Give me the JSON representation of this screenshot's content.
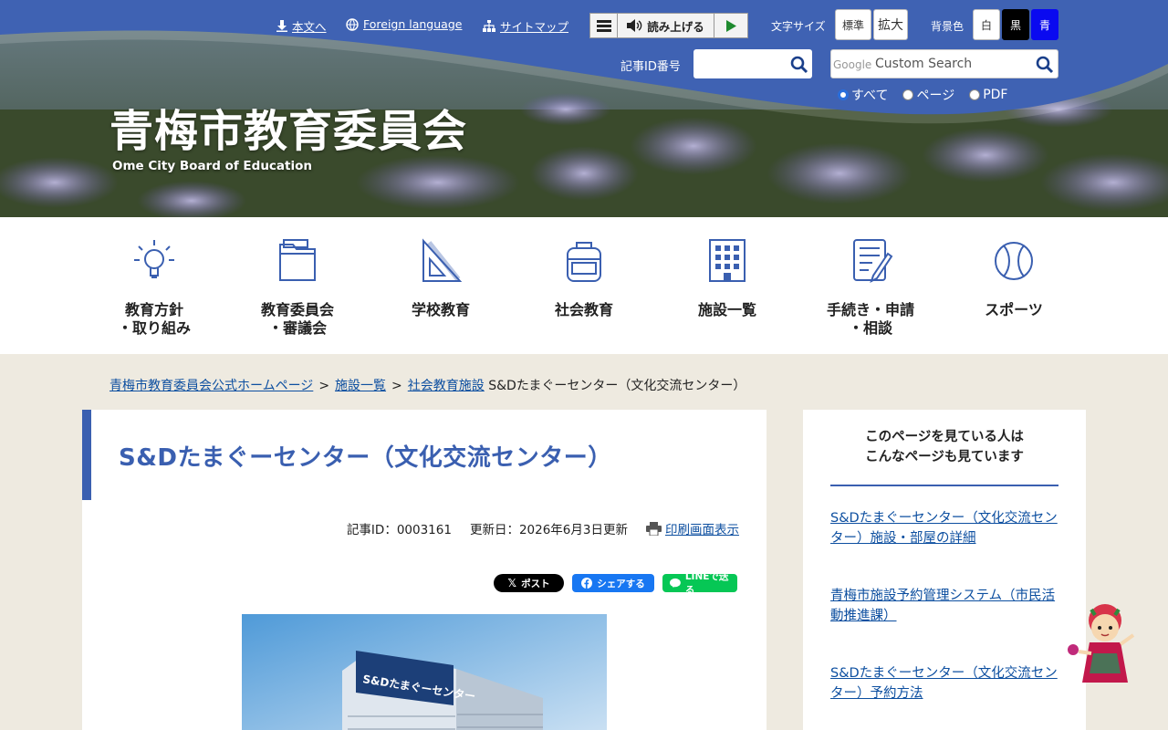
{
  "utility": {
    "skip_label": "本文へ",
    "foreign_label": "Foreign language",
    "sitemap_label": "サイトマップ",
    "read_aloud_label": "読み上げる",
    "font_size_label": "文字サイズ",
    "font_standard": "標準",
    "font_large": "拡大",
    "bg_label": "背景色",
    "bg_white": "白",
    "bg_black": "黒",
    "bg_blue": "青"
  },
  "search": {
    "article_id_label": "記事ID番号",
    "google_label": "Google",
    "placeholder": "Custom Search",
    "scope": [
      {
        "label": "すべて",
        "checked": true
      },
      {
        "label": "ページ",
        "checked": false
      },
      {
        "label": "PDF",
        "checked": false
      }
    ]
  },
  "brand": {
    "title": "青梅市教育委員会",
    "subtitle": "Ome City Board of Education"
  },
  "nav": [
    {
      "line1": "教育方針",
      "line2": "・取り組み",
      "icon": "lightbulb-icon"
    },
    {
      "line1": "教育委員会",
      "line2": "・審議会",
      "icon": "folder-icon"
    },
    {
      "line1": "学校教育",
      "line2": "",
      "icon": "ruler-triangle-icon"
    },
    {
      "line1": "社会教育",
      "line2": "",
      "icon": "backpack-icon"
    },
    {
      "line1": "施設一覧",
      "line2": "",
      "icon": "building-icon"
    },
    {
      "line1": "手続き・申請",
      "line2": "・相談",
      "icon": "form-pen-icon"
    },
    {
      "line1": "スポーツ",
      "line2": "",
      "icon": "ball-icon"
    }
  ],
  "breadcrumb": {
    "home": "青梅市教育委員会公式ホームページ",
    "level1": "施設一覧",
    "level2": "社会教育施設",
    "current": "S&Dたまぐーセンター（文化交流センター）",
    "separator": ">"
  },
  "article": {
    "title": "S&Dたまぐーセンター（文化交流センター）",
    "article_id": "記事ID：0003161",
    "updated": "更新日：2026年6月3日更新",
    "print_label": "印刷画面表示",
    "photo_sign": "S&Dたまぐーセンター"
  },
  "share": {
    "x_label": "ポスト",
    "fb_label": "シェアする",
    "line_label": "LINEで送る"
  },
  "sidebar": {
    "heading_line1": "このページを見ている人は",
    "heading_line2": "こんなページも見ています",
    "links": [
      "S&Dたまぐーセンター（文化交流センター）施設・部屋の詳細",
      "青梅市施設予約管理システム（市民活動推進課）",
      "S&Dたまぐーセンター（文化交流センター）予約方法"
    ]
  },
  "colors": {
    "brand_blue": "#3a5fb0",
    "link": "#0d4fa0",
    "page_bg": "#eeeae0"
  }
}
